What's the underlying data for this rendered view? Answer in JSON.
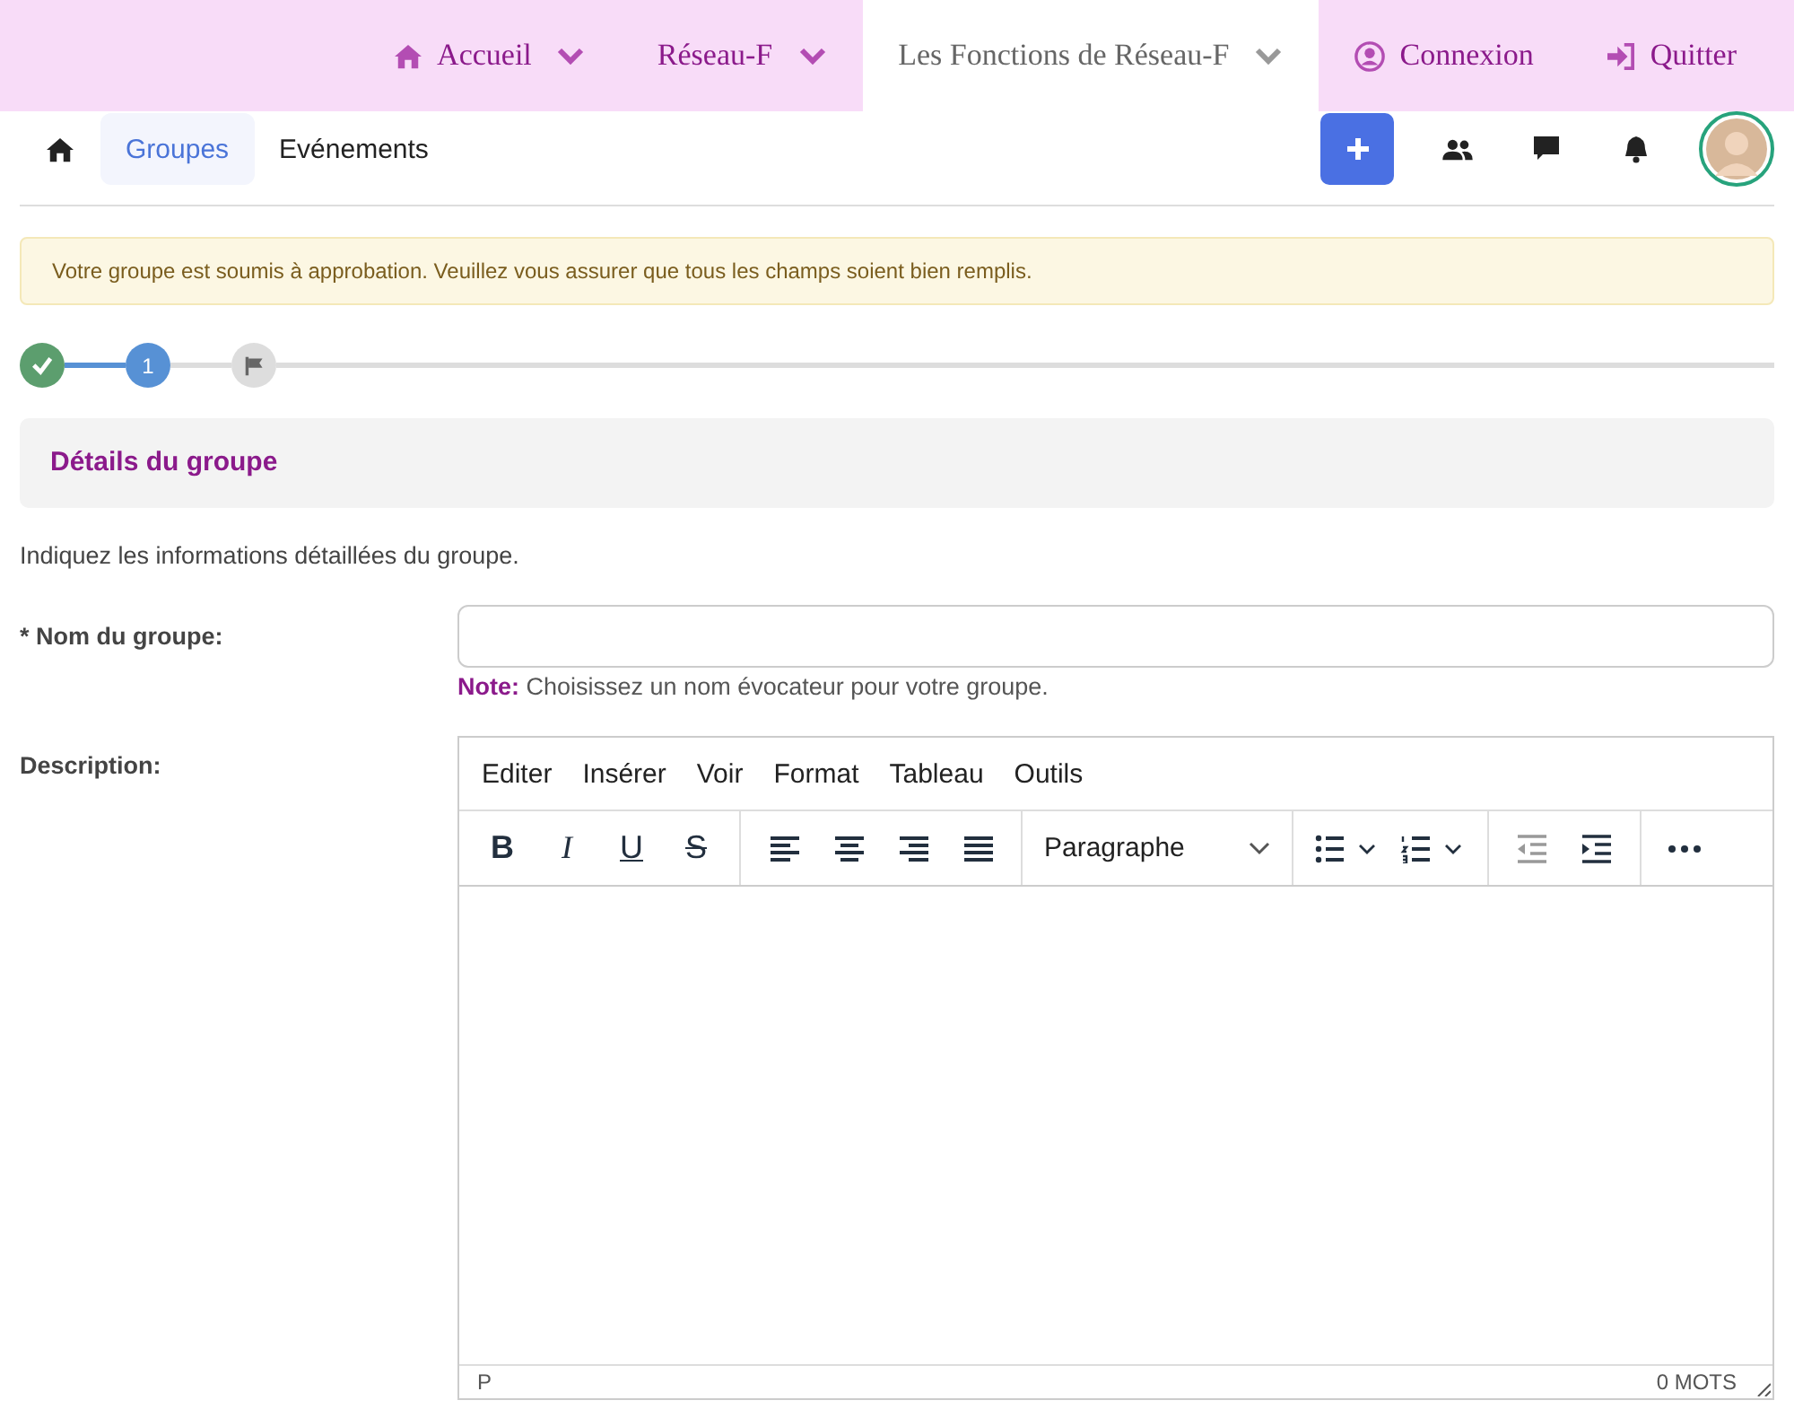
{
  "top_nav": [
    {
      "kind": "home",
      "label": "Accueil",
      "caret": true,
      "selected": false
    },
    {
      "kind": "plain",
      "label": "Réseau-F",
      "caret": true,
      "selected": false
    },
    {
      "kind": "plain",
      "label": "Les Fonctions de Réseau-F",
      "caret": true,
      "selected": true
    },
    {
      "kind": "user",
      "label": "Connexion",
      "caret": false,
      "selected": false
    },
    {
      "kind": "logout",
      "label": "Quitter",
      "caret": false,
      "selected": false
    }
  ],
  "sub_nav": {
    "tabs": [
      {
        "kind": "home",
        "selected": false
      },
      {
        "kind": "text",
        "label": "Groupes",
        "selected": true
      },
      {
        "kind": "text",
        "label": "Evénements",
        "selected": false
      }
    ],
    "actions": [
      {
        "kind": "plus"
      },
      {
        "kind": "users"
      },
      {
        "kind": "chat"
      },
      {
        "kind": "bell"
      },
      {
        "kind": "avatar"
      }
    ]
  },
  "alert": "Votre groupe est soumis à approbation. Veuillez vous assurer que tous les champs soient bien remplis.",
  "steps": [
    {
      "kind": "done"
    },
    {
      "kind": "current",
      "label": "1"
    },
    {
      "kind": "pending"
    }
  ],
  "section_title": "Détails du groupe",
  "intro": "Indiquez les informations détaillées du groupe.",
  "name_field": {
    "label": "* Nom du groupe:",
    "note_label": "Note:",
    "note": "Choisissez un nom évocateur pour votre groupe."
  },
  "description": {
    "label": "Description:",
    "menu": [
      "Editer",
      "Insérer",
      "Voir",
      "Format",
      "Tableau",
      "Outils"
    ],
    "toolbar": [
      [
        {
          "kind": "bold",
          "label": "B",
          "disabled": false
        },
        {
          "kind": "italic",
          "label": "I",
          "disabled": false
        },
        {
          "kind": "underline",
          "label": "U",
          "disabled": false
        },
        {
          "kind": "strike",
          "label": "S",
          "disabled": false
        }
      ],
      [
        {
          "kind": "align-left",
          "disabled": false
        },
        {
          "kind": "align-center",
          "disabled": false
        },
        {
          "kind": "align-right",
          "disabled": false
        },
        {
          "kind": "justify",
          "disabled": false
        }
      ],
      [
        {
          "kind": "select",
          "label": "Paragraphe",
          "disabled": false
        }
      ],
      [
        {
          "kind": "bullets",
          "disabled": false
        },
        {
          "kind": "numbers",
          "disabled": false
        }
      ],
      [
        {
          "kind": "outdent",
          "disabled": true
        },
        {
          "kind": "indent",
          "disabled": false
        }
      ],
      [
        {
          "kind": "more",
          "disabled": false
        }
      ]
    ],
    "path": "P",
    "word_count": "0 MOTS"
  }
}
